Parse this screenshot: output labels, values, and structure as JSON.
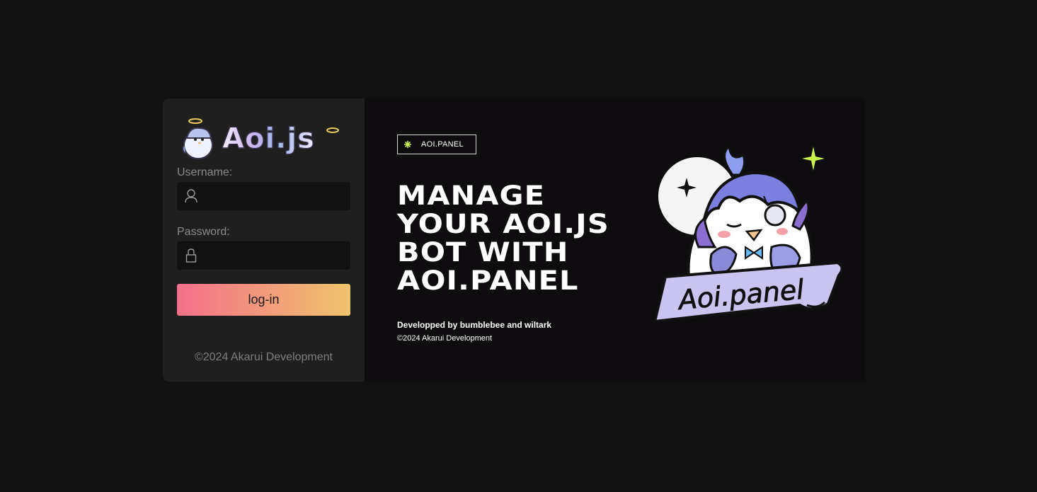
{
  "login": {
    "logo_text": "Aoi.js",
    "username_label": "Username:",
    "username_value": "",
    "password_label": "Password:",
    "password_value": "",
    "login_button": "log-in",
    "copyright": "©2024 Akarui Development"
  },
  "hero": {
    "badge": "AOI.PANEL",
    "title_lines": [
      "MANAGE",
      "YOUR AOI.JS",
      "BOT WITH",
      "AOI.PANEL"
    ],
    "credit": "Developped by bumblebee and wiltark",
    "copyright": "©2024 Akarui Development",
    "mascot_banner": "Aoi.panel"
  },
  "colors": {
    "background": "#111111",
    "login_panel": "#1f1f1f",
    "hero_panel": "#0f0c0f",
    "button_gradient_start": "#f4708a",
    "button_gradient_end": "#f0c46c",
    "accent_sparkle": "#c6f24a"
  },
  "icons": {
    "username": "user-icon",
    "password": "lock-icon",
    "badge": "sparkle-icon"
  }
}
